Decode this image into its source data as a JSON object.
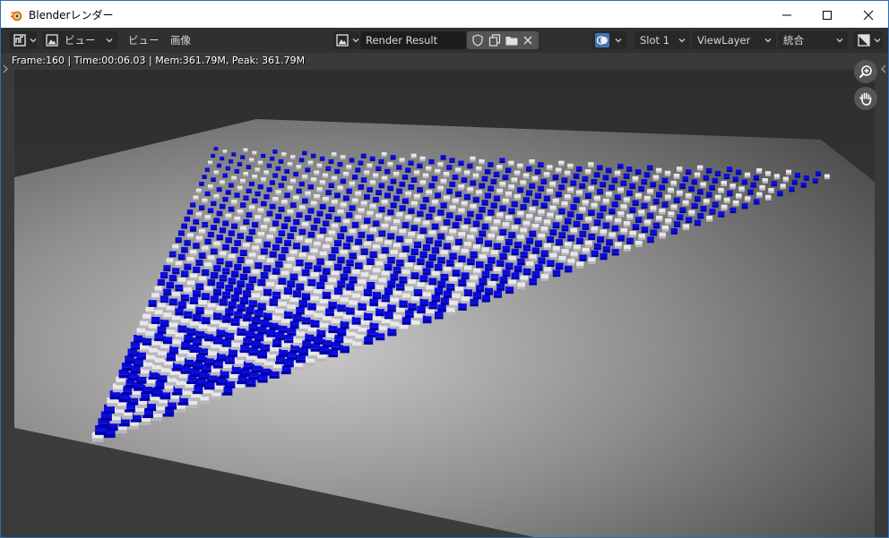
{
  "window": {
    "title": "Blenderレンダー",
    "minimize_icon": "minimize-icon",
    "maximize_icon": "maximize-icon",
    "close_icon": "close-icon"
  },
  "header": {
    "editor_type_icon": "image-editor-icon",
    "view_menu_icon": "image-icon",
    "view_menu_label": "ビュー",
    "menu_view": "ビュー",
    "menu_image": "画像",
    "image_browse_icon": "image-browse-icon",
    "image_name": "Render Result",
    "fake_user_icon": "shield-icon",
    "new_image_icon": "duplicate-icon",
    "open_image_icon": "folder-icon",
    "unlink_icon": "close-icon",
    "display_channels_icon": "color-alpha-icon",
    "slot": "Slot 1",
    "view_layer": "ViewLayer",
    "pass": "統合",
    "gizmo_icon": "view-options-icon"
  },
  "viewport": {
    "stats": "Frame:160 | Time:00:06.03 | Mem:361.79M, Peak: 361.79M",
    "zoom_icon": "zoom-icon",
    "pan_icon": "hand-icon",
    "render_colors": {
      "blue": "#0a0ae0",
      "white": "#e8e8ec",
      "floor": "#7a7a7a",
      "background": "#3a3a3a"
    }
  }
}
